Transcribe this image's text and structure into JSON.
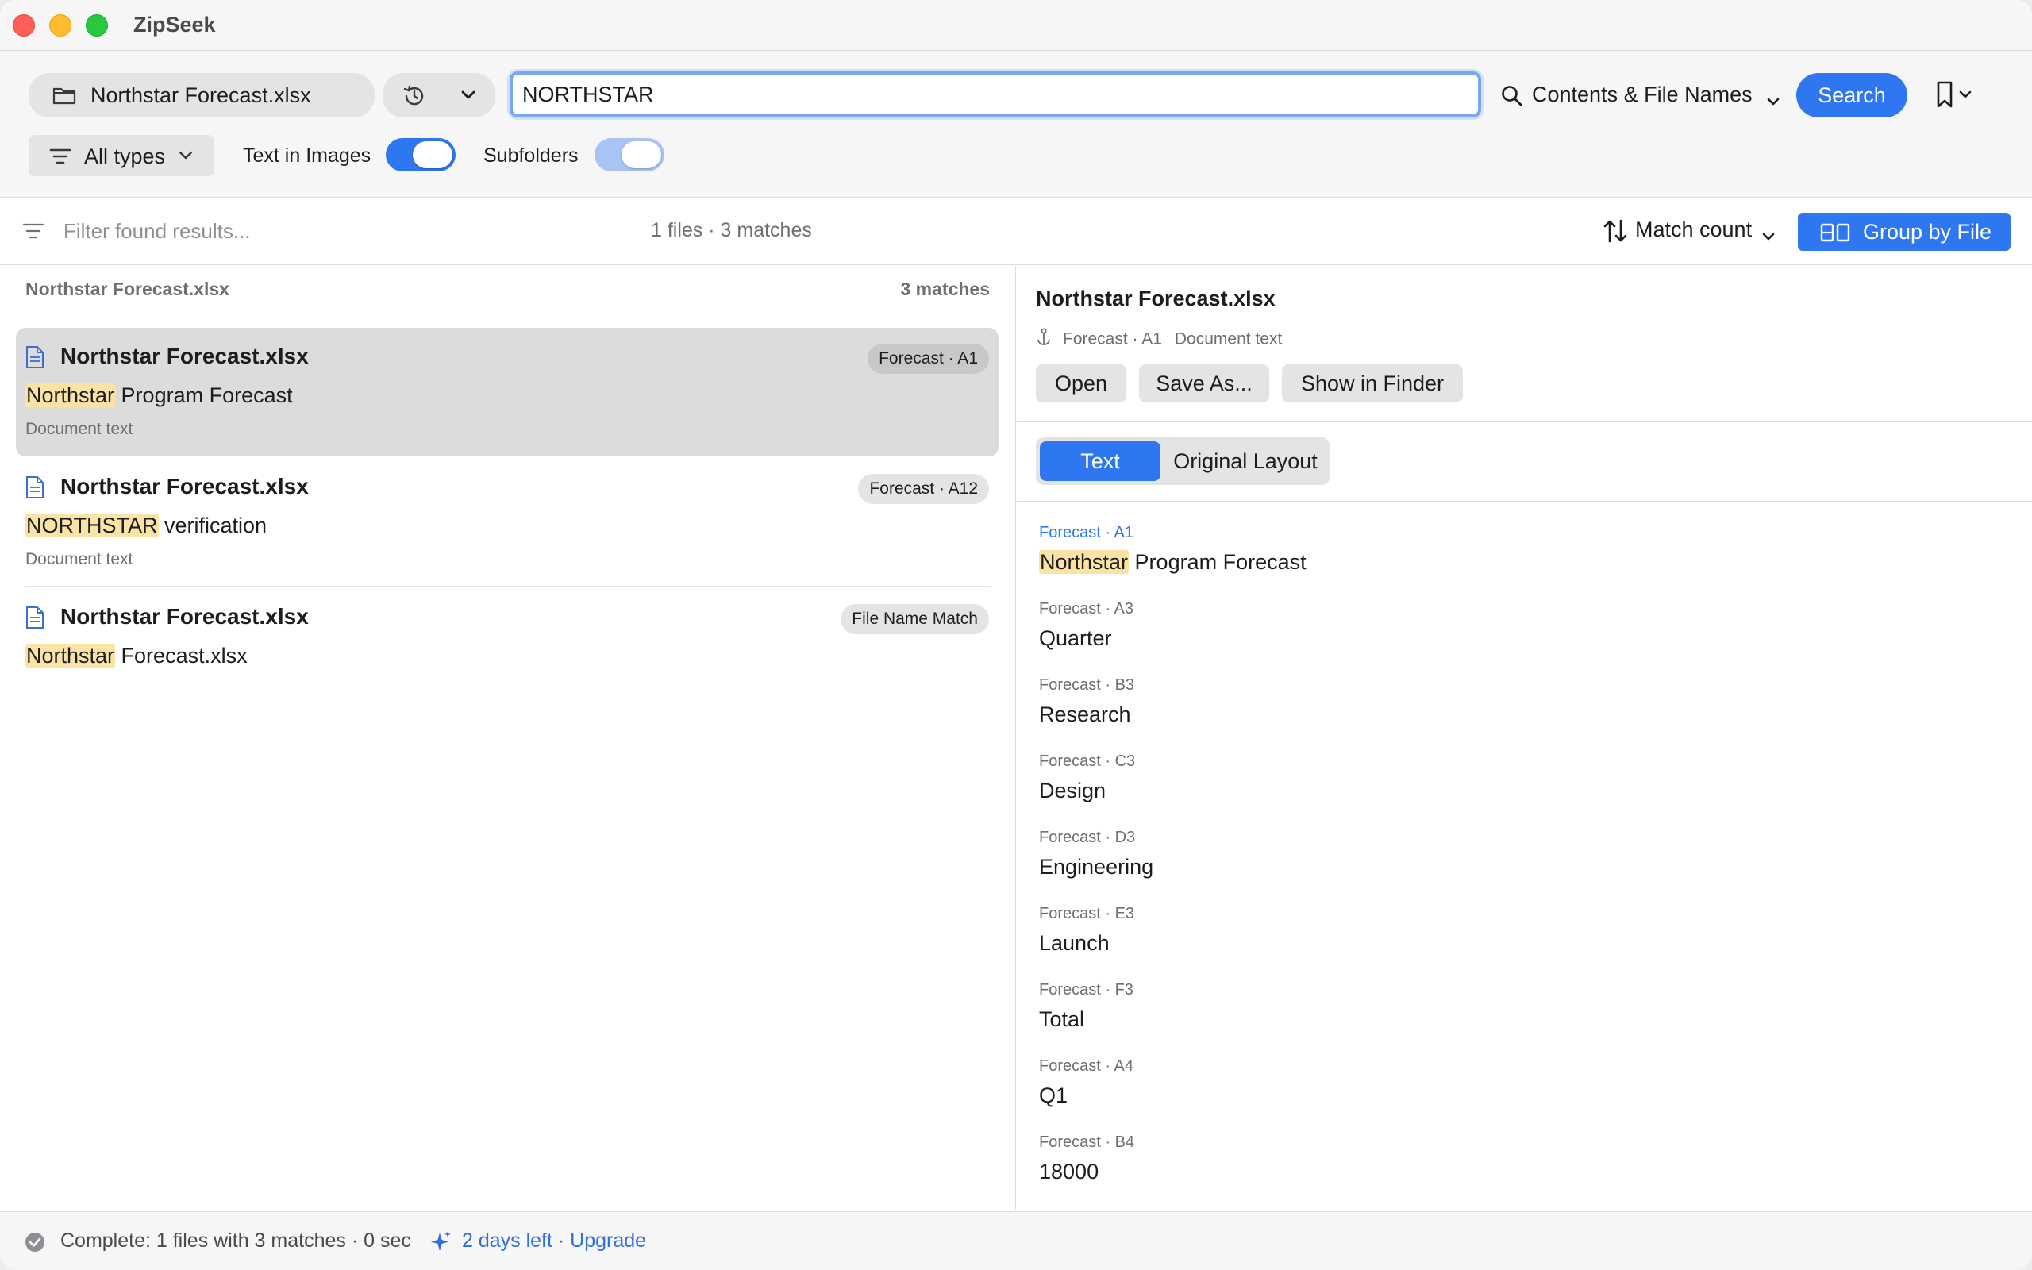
{
  "app": {
    "title": "ZipSeek"
  },
  "toolbar": {
    "folder_label": "Northstar Forecast.xlsx",
    "search_value": "NORTHSTAR",
    "scope_label": "Contents & File Names",
    "search_button": "Search",
    "types_label": "All types",
    "text_in_images_label": "Text in Images",
    "text_in_images_on": true,
    "subfolders_label": "Subfolders",
    "subfolders_on": true
  },
  "filterbar": {
    "placeholder": "Filter found results...",
    "counts": "1 files · 3 matches",
    "sort_label": "Match count",
    "group_button": "Group by File"
  },
  "results": {
    "group_name": "Northstar Forecast.xlsx",
    "group_count": "3 matches",
    "items": [
      {
        "file": "Northstar Forecast.xlsx",
        "badge": "Forecast · A1",
        "match": "Northstar",
        "rest": " Program Forecast",
        "kind": "Document text",
        "selected": true
      },
      {
        "file": "Northstar Forecast.xlsx",
        "badge": "Forecast · A12",
        "match": "NORTHSTAR",
        "rest": " verification",
        "kind": "Document text",
        "selected": false
      },
      {
        "file": "Northstar Forecast.xlsx",
        "badge": "File Name Match",
        "match": "Northstar",
        "rest": " Forecast.xlsx",
        "kind": "",
        "selected": false
      }
    ]
  },
  "preview": {
    "title": "Northstar Forecast.xlsx",
    "meta_location": "Forecast · A1",
    "meta_kind": "Document text",
    "open_button": "Open",
    "save_as_button": "Save As...",
    "show_in_finder_button": "Show in Finder",
    "tab_text": "Text",
    "tab_original": "Original Layout",
    "cells": [
      {
        "ref": "Forecast · A1",
        "match": "Northstar",
        "value": " Program Forecast"
      },
      {
        "ref": "Forecast · A3",
        "match": "",
        "value": "Quarter"
      },
      {
        "ref": "Forecast · B3",
        "match": "",
        "value": "Research"
      },
      {
        "ref": "Forecast · C3",
        "match": "",
        "value": "Design"
      },
      {
        "ref": "Forecast · D3",
        "match": "",
        "value": "Engineering"
      },
      {
        "ref": "Forecast · E3",
        "match": "",
        "value": "Launch"
      },
      {
        "ref": "Forecast · F3",
        "match": "",
        "value": "Total"
      },
      {
        "ref": "Forecast · A4",
        "match": "",
        "value": "Q1"
      },
      {
        "ref": "Forecast · B4",
        "match": "",
        "value": "18000"
      }
    ]
  },
  "status": {
    "text": "Complete: 1 files with 3 matches · 0 sec",
    "trial_days": "2 days left",
    "trial_sep": " · ",
    "upgrade": "Upgrade"
  },
  "colors": {
    "accent": "#2f76f1",
    "highlight": "#fbe3a6"
  },
  "icons": [
    "folder-icon",
    "history-icon",
    "chevron-down-icon",
    "search-icon",
    "bookmark-icon",
    "filter-lines-icon",
    "sort-arrows-icon",
    "group-icon",
    "document-icon",
    "anchor-icon",
    "check-circle-icon",
    "sparkle-icon"
  ]
}
